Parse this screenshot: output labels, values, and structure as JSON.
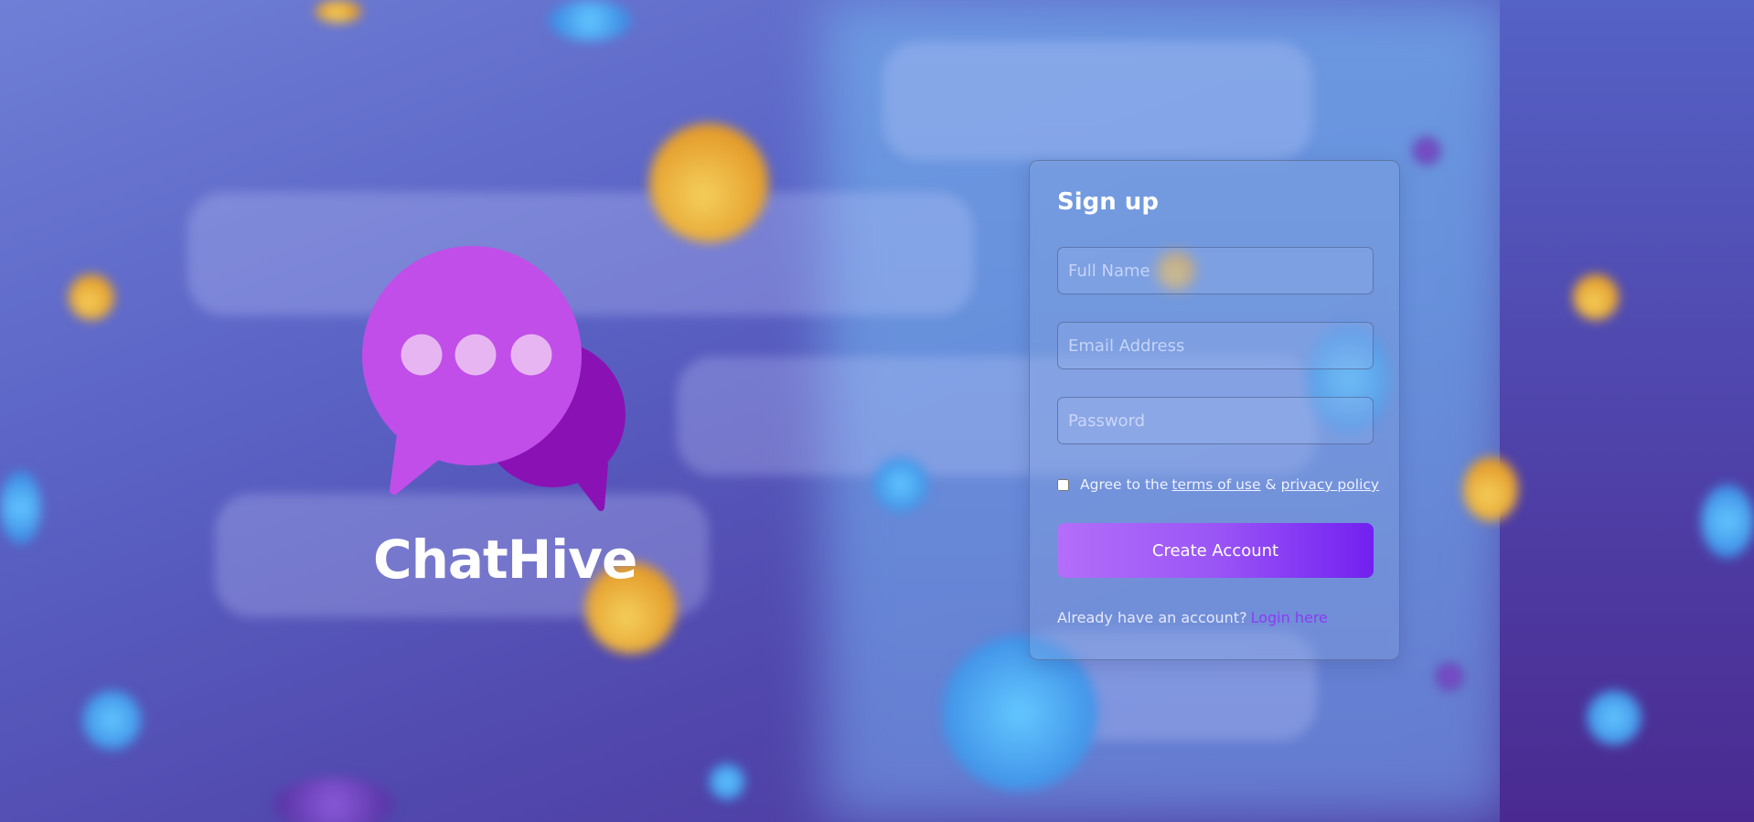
{
  "brand": {
    "name": "ChatHive",
    "logo_icon": "chat-bubbles-icon",
    "colors": {
      "bubble_primary": "#c14ee8",
      "bubble_secondary": "#8a12b4",
      "dots": "#e7b6f2"
    }
  },
  "signup": {
    "title": "Sign up",
    "full_name_placeholder": "Full Name",
    "email_placeholder": "Email Address",
    "password_placeholder": "Password",
    "agree_prefix": "Agree to the",
    "terms_link": "terms of use",
    "ampersand": "&",
    "privacy_link": "privacy policy",
    "agree_checked": false,
    "submit_label": "Create Account",
    "login_prompt": "Already have an account?",
    "login_link": "Login here",
    "colors": {
      "button_start": "#b36ef9",
      "button_end": "#7220f0",
      "login_link": "#8a3df2"
    }
  }
}
